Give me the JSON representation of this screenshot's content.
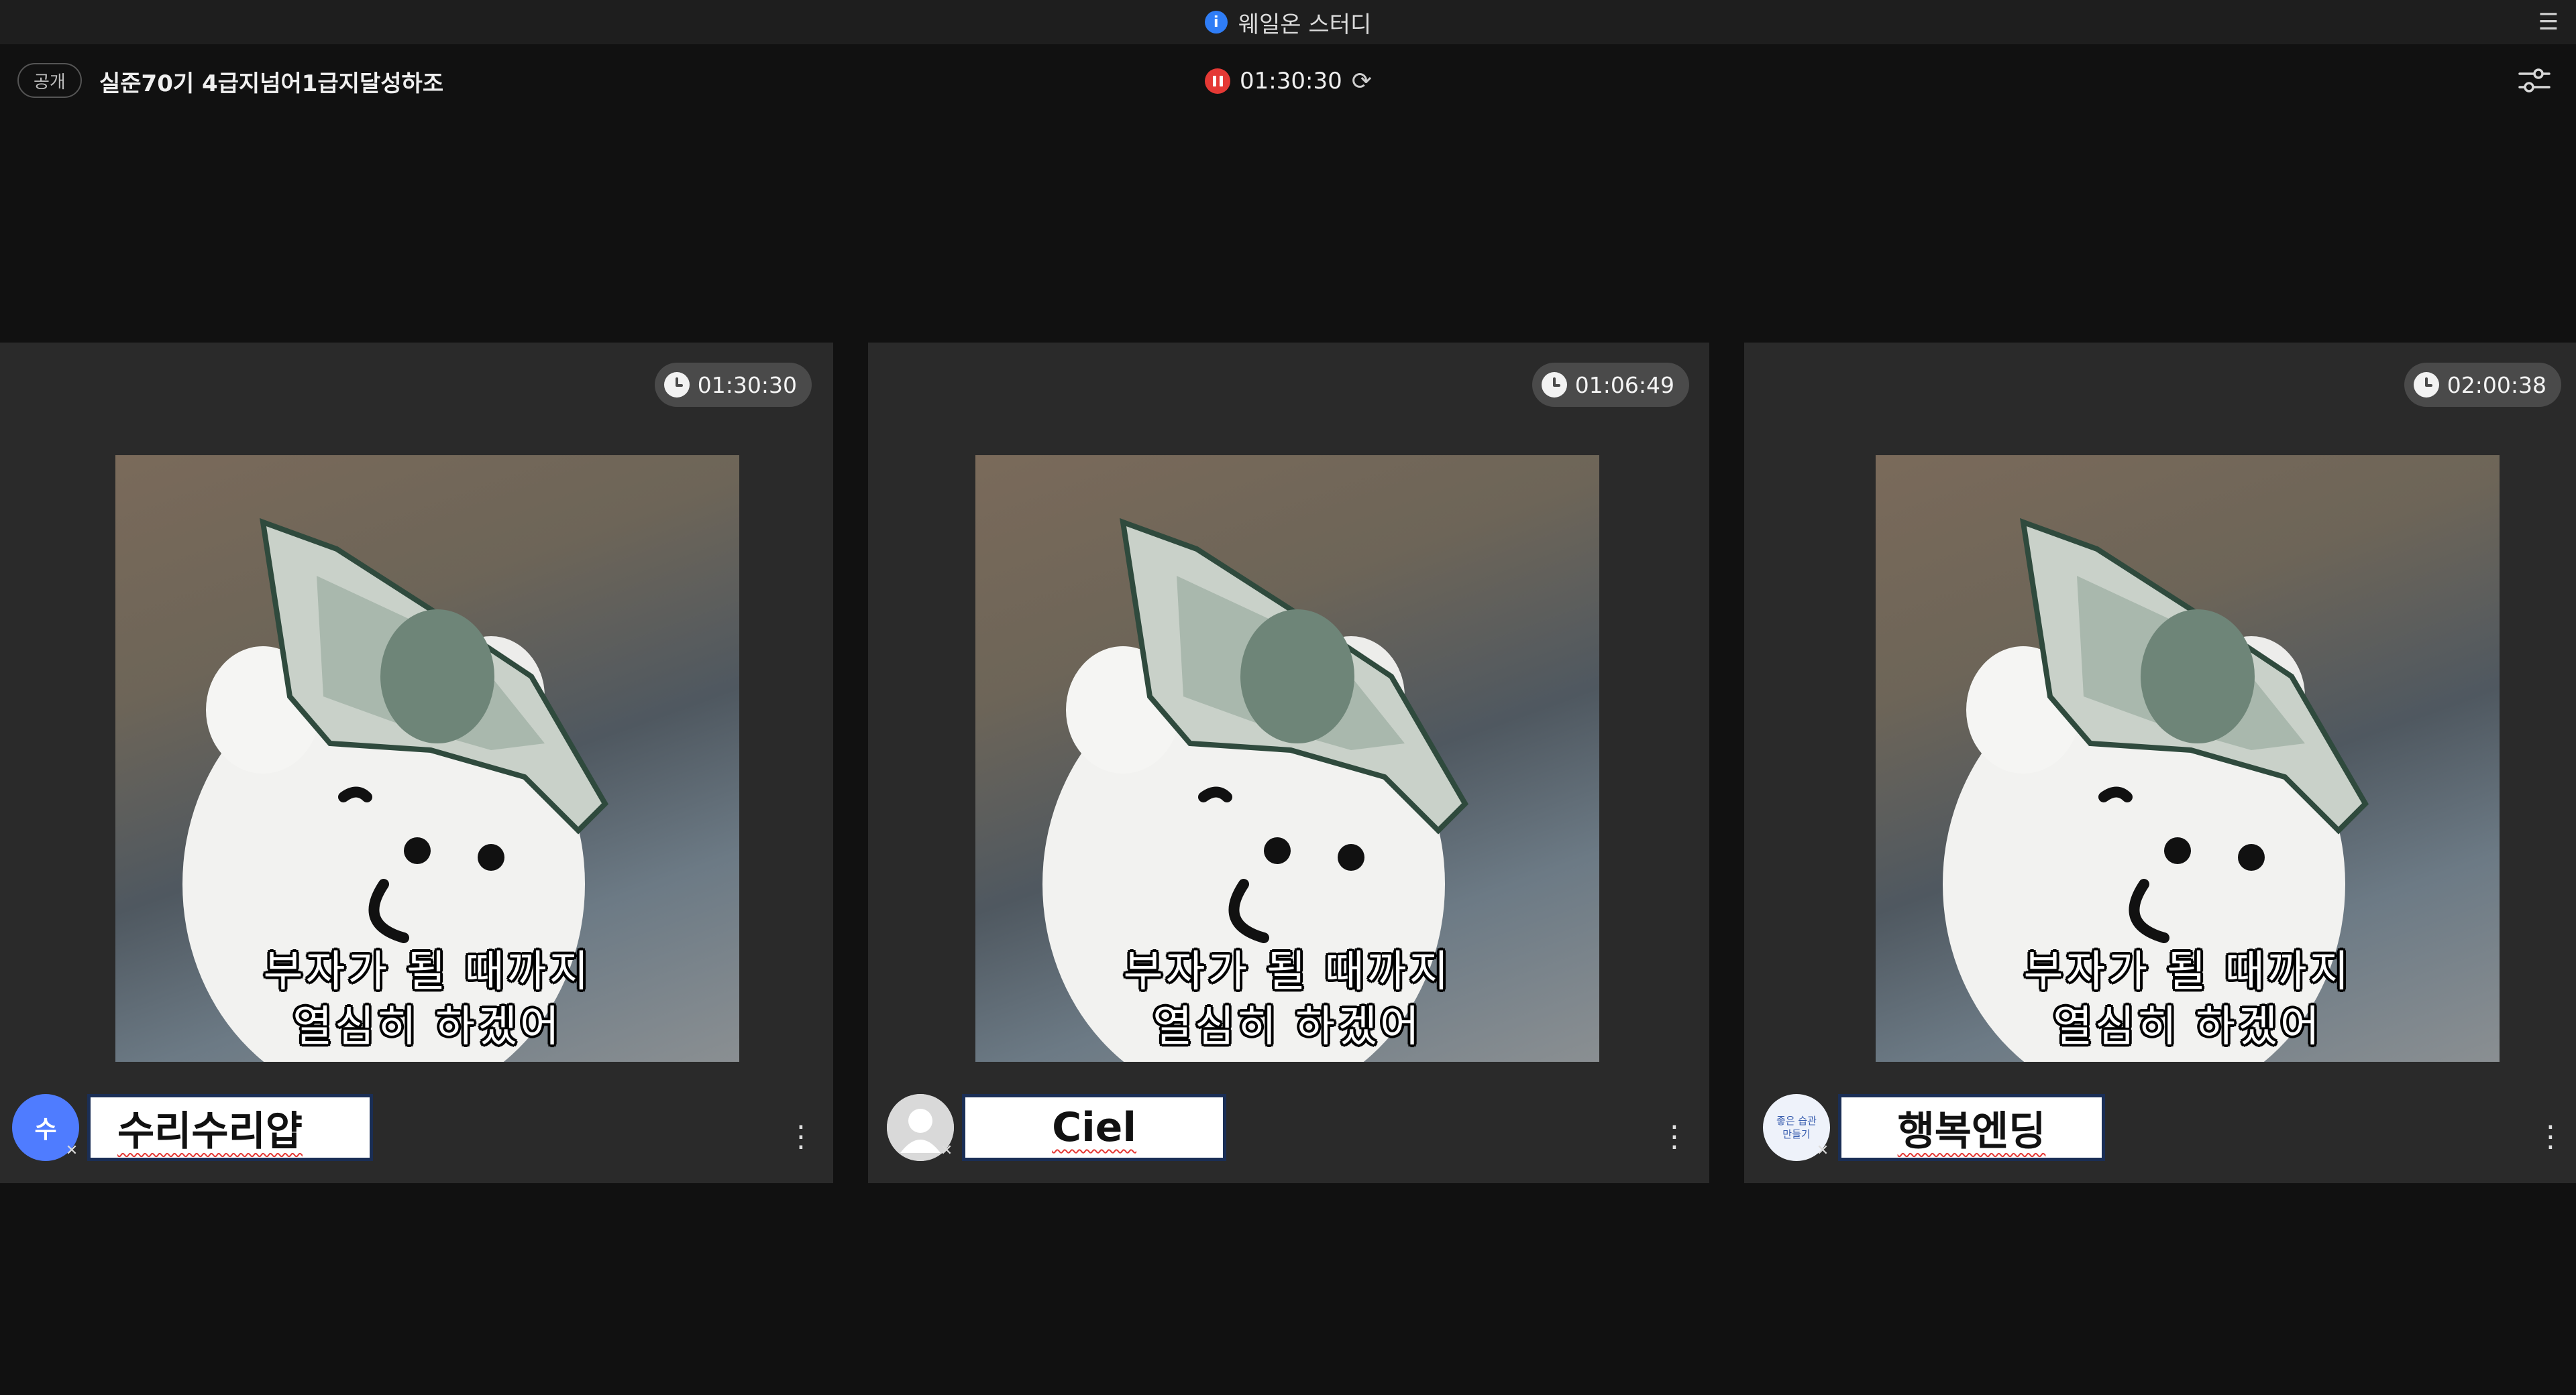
{
  "app": {
    "title": "웨일온 스터디",
    "info_icon": "i"
  },
  "room": {
    "visibility": "공개",
    "name": "실준70기 4급지넘어1급지달성하조",
    "timer": "01:30:30"
  },
  "caption": {
    "line1": "부자가 될 때까지",
    "line2": "열심히 하겠어"
  },
  "participants": [
    {
      "name": "수리수리얍",
      "time": "01:30:30",
      "avatar_initial": "수",
      "avatar_color": "#4f7cff"
    },
    {
      "name": "Ciel",
      "time": "01:06:49",
      "avatar_initial": "",
      "avatar_color": "#d9d9d9"
    },
    {
      "name": "행복엔딩",
      "time": "02:00:38",
      "avatar_text_line1": "좋은 습관",
      "avatar_text_line2": "만들기",
      "avatar_color": "#eef2fa"
    }
  ],
  "icons": {
    "menu": "sort-menu-icon",
    "settings": "sliders-icon",
    "pause": "pause-icon",
    "refresh": "refresh-icon",
    "clock": "clock-icon",
    "mute": "mic-off-icon",
    "more": "kebab-menu-icon"
  }
}
